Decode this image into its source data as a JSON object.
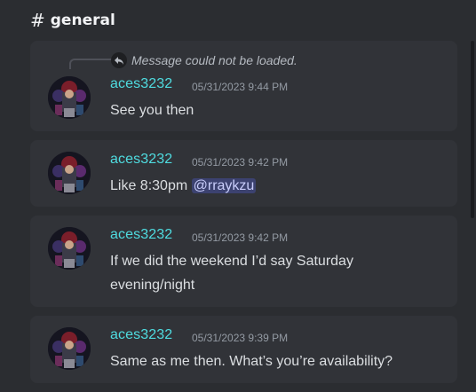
{
  "channel": {
    "hash": "#",
    "name": "general"
  },
  "messages": [
    {
      "reply": {
        "text": "Message could not be loaded."
      },
      "username": "aces3232",
      "timestamp": "05/31/2023 9:44 PM",
      "text": "See you then"
    },
    {
      "username": "aces3232",
      "timestamp": "05/31/2023 9:42 PM",
      "text": "Like 8:30pm",
      "mention": "@rraykzu"
    },
    {
      "username": "aces3232",
      "timestamp": "05/31/2023 9:42 PM",
      "text_line1": "If we did the weekend I’d say Saturday",
      "text_line2": "evening/night"
    },
    {
      "username": "aces3232",
      "timestamp": "05/31/2023 9:39 PM",
      "text": "Same as me then. What’s you’re availability?"
    }
  ],
  "colors": {
    "background": "#2b2d31",
    "card": "#313338",
    "username": "#4fdce0",
    "mention_bg": "#3c4270"
  },
  "icons": [
    "reply-arrow-icon",
    "avatar"
  ]
}
